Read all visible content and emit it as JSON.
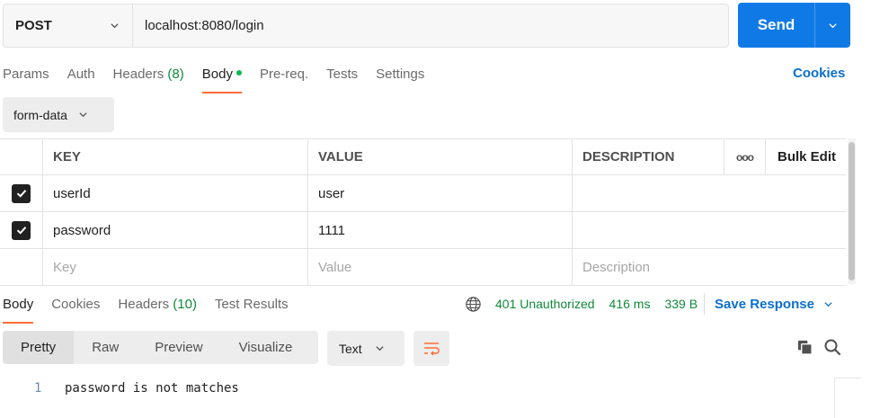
{
  "request": {
    "method": "POST",
    "url": "localhost:8080/login",
    "send_label": "Send"
  },
  "request_tabs": [
    {
      "label": "Params"
    },
    {
      "label": "Auth"
    },
    {
      "label": "Headers",
      "count": "(8)"
    },
    {
      "label": "Body"
    },
    {
      "label": "Pre-req."
    },
    {
      "label": "Tests"
    },
    {
      "label": "Settings"
    }
  ],
  "cookies_label": "Cookies",
  "body_type": "form-data",
  "table": {
    "headers": {
      "key": "KEY",
      "value": "VALUE",
      "description": "DESCRIPTION",
      "more": "ooo",
      "bulk_edit": "Bulk Edit"
    },
    "rows": [
      {
        "key": "userId",
        "value": "user",
        "description": ""
      },
      {
        "key": "password",
        "value": "1111",
        "description": ""
      }
    ],
    "placeholders": {
      "key": "Key",
      "value": "Value",
      "description": "Description"
    }
  },
  "response_tabs": [
    {
      "label": "Body"
    },
    {
      "label": "Cookies"
    },
    {
      "label": "Headers",
      "count": "(10)"
    },
    {
      "label": "Test Results"
    }
  ],
  "response_meta": {
    "status": "401 Unauthorized",
    "time": "416 ms",
    "size": "339 B",
    "save_label": "Save Response"
  },
  "view_modes": [
    "Pretty",
    "Raw",
    "Preview",
    "Visualize"
  ],
  "format": "Text",
  "code": {
    "line_number": "1",
    "text": "password is not matches"
  },
  "colors": {
    "accent_orange": "#ff6c37",
    "send_blue": "#0f7ae5",
    "status_green": "#0f8a3a",
    "link_blue": "#0b6fcd"
  }
}
